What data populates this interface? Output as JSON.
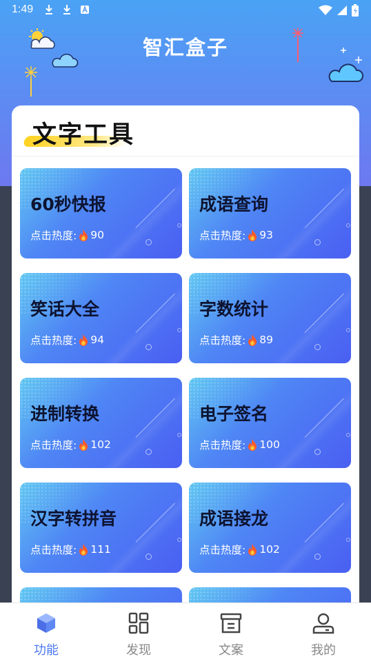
{
  "status_bar": {
    "time": "1:49"
  },
  "app_title": "智汇盒子",
  "section": {
    "title": "文字工具"
  },
  "heat_prefix": "点击热度:",
  "tools": [
    {
      "name": "60秒快报",
      "heat": "90"
    },
    {
      "name": "成语查询",
      "heat": "93"
    },
    {
      "name": "笑话大全",
      "heat": "94"
    },
    {
      "name": "字数统计",
      "heat": "89"
    },
    {
      "name": "进制转换",
      "heat": "102"
    },
    {
      "name": "电子签名",
      "heat": "100"
    },
    {
      "name": "汉字转拼音",
      "heat": "111"
    },
    {
      "name": "成语接龙",
      "heat": "102"
    }
  ],
  "tabs": [
    {
      "label": "功能",
      "icon": "cube-icon",
      "active": true
    },
    {
      "label": "发现",
      "icon": "grid-icon",
      "active": false
    },
    {
      "label": "文案",
      "icon": "archive-icon",
      "active": false
    },
    {
      "label": "我的",
      "icon": "user-icon",
      "active": false
    }
  ],
  "colors": {
    "accent": "#4c78f0",
    "header_top": "#4aa3f5",
    "header_bottom": "#6d78ef",
    "highlight": "#ffd21f"
  }
}
